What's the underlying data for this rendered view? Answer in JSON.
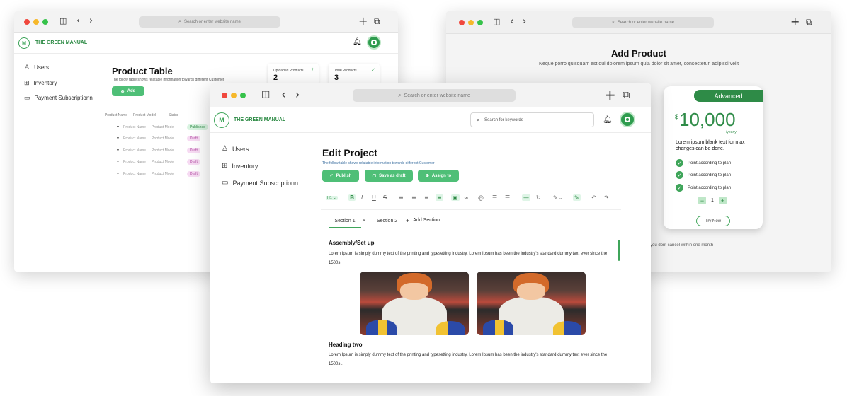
{
  "browser": {
    "url_placeholder": "Search or enter website name"
  },
  "app": {
    "brand": "THE GREEN MANUAL",
    "sidebar": [
      "Users",
      "Inventory",
      "Payment Subscriptionn"
    ]
  },
  "product_table": {
    "title": "Product Table",
    "subtitle": "The follow table shows relatable information towards different Customer",
    "add_label": "Add",
    "stats": [
      {
        "label": "Uploaded Products",
        "value": "2"
      },
      {
        "label": "Total Products",
        "value": "3"
      }
    ],
    "columns": [
      "Product Name",
      "Product Model",
      "Status"
    ],
    "rows": [
      {
        "name": "Product Name",
        "model": "Product Model",
        "status": "Published"
      },
      {
        "name": "Product Name",
        "model": "Product Model",
        "status": "Draft"
      },
      {
        "name": "Product Name",
        "model": "Product Model",
        "status": "Draft"
      },
      {
        "name": "Product Name",
        "model": "Product Model",
        "status": "Draft"
      },
      {
        "name": "Product Name",
        "model": "Product Model",
        "status": "Draft"
      }
    ]
  },
  "add_product": {
    "title": "Add Product",
    "subtitle": "Neque porro quisquam est qui dolorem ipsum quia dolor sit amet, consectetur, adipisci velit",
    "plan": {
      "name": "Advanced",
      "currency": "$",
      "price": "10,000",
      "period": "/yearly",
      "description": "Lorem ipsum blank text for max changes can be done.",
      "features": [
        "Point according to plan",
        "Point according to plan",
        "Point according to plan"
      ],
      "quantity": "1",
      "cta": "Try Now"
    },
    "footnote": "you dont cancel within one month"
  },
  "edit_project": {
    "search_placeholder": "Search for keywords",
    "title": "Edit Project",
    "subtitle": "The follow table shows relatable information towards different Customer",
    "actions": {
      "publish": "Publish",
      "draft": "Save as draft",
      "assign": "Assign to"
    },
    "toolbar_heading": "H1",
    "tabs": [
      "Section 1",
      "Section 2"
    ],
    "add_section": "Add Section",
    "content": [
      {
        "heading": "Assembly/Set up",
        "text": "Lorem Ipsum is simply dummy text of the printing and typesetting industry. Lorem Ipsum has been the industry's standard dummy text ever since the 1500s"
      },
      {
        "heading": "Heading two",
        "text": "Lorem Ipsum is simply dummy text of the printing and typesetting industry. Lorem Ipsum has been the industry's standard dummy text ever since the 1500s ."
      }
    ]
  },
  "colors": {
    "accent": "#4fbf77",
    "brand": "#2c8a44",
    "draft_pill": "#f7dbf3"
  }
}
